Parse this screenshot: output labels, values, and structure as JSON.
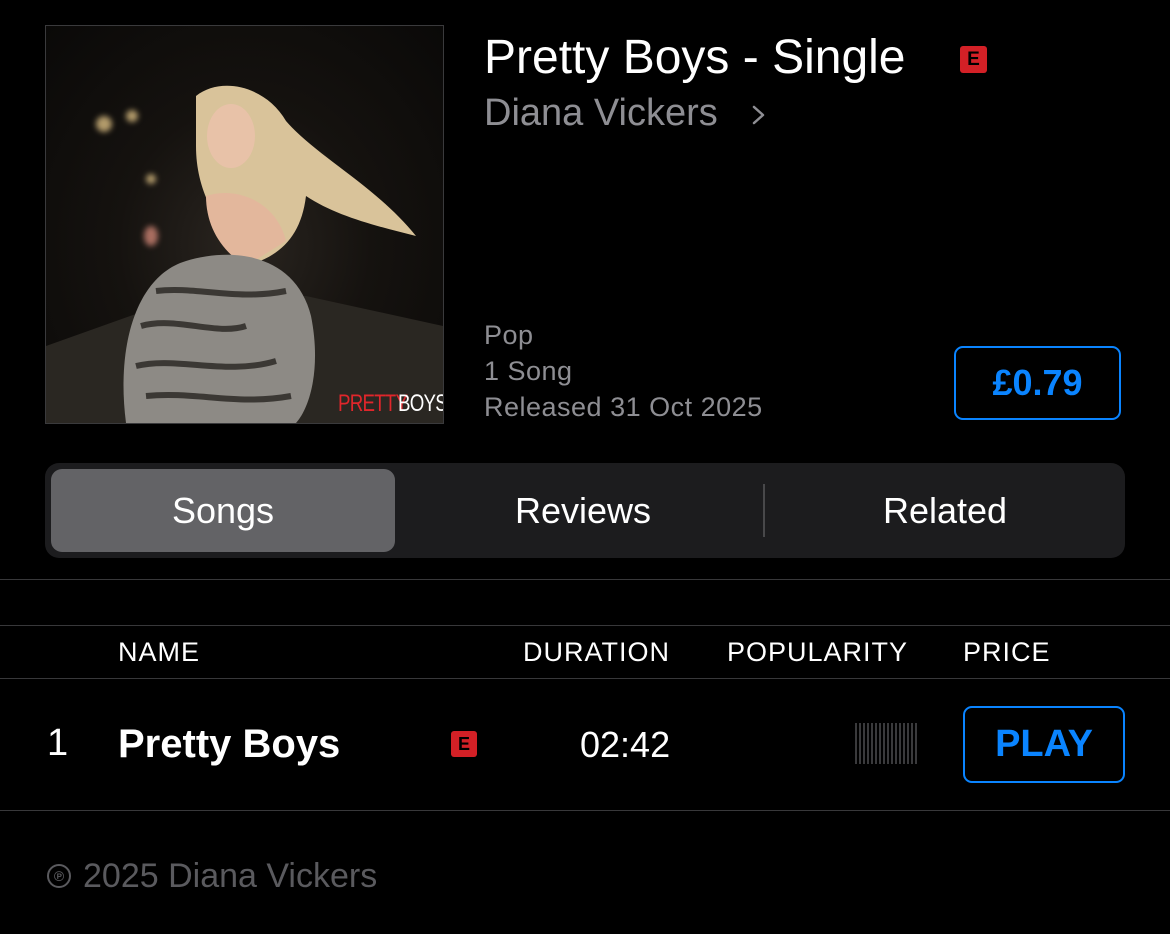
{
  "album": {
    "title": "Pretty Boys - Single",
    "explicit_badge": "E",
    "artist": "Diana Vickers",
    "genre": "Pop",
    "song_count": "1 Song",
    "release": "Released 31 Oct 2025",
    "price": "£0.79",
    "cover_text": {
      "pretty": "PRETTY",
      "boys": "BOYS"
    }
  },
  "tabs": [
    {
      "label": "Songs",
      "selected": true
    },
    {
      "label": "Reviews",
      "selected": false
    },
    {
      "label": "Related",
      "selected": false
    }
  ],
  "table": {
    "headers": {
      "name": "NAME",
      "duration": "DURATION",
      "popularity": "POPULARITY",
      "price": "PRICE"
    },
    "rows": [
      {
        "number": "1",
        "name": "Pretty Boys",
        "explicit": "E",
        "duration": "02:42",
        "popularity_level": 0,
        "action": "PLAY"
      }
    ]
  },
  "footer": {
    "copyright_symbol": "℗",
    "copyright": "2025 Diana Vickers"
  },
  "colors": {
    "accent": "#0a84ff",
    "explicit": "#d32026",
    "secondary_text": "#8e8e93",
    "background": "#000000"
  },
  "icons": {
    "artist_link": "chevron-right-icon",
    "copyright": "phonogram-icon"
  }
}
